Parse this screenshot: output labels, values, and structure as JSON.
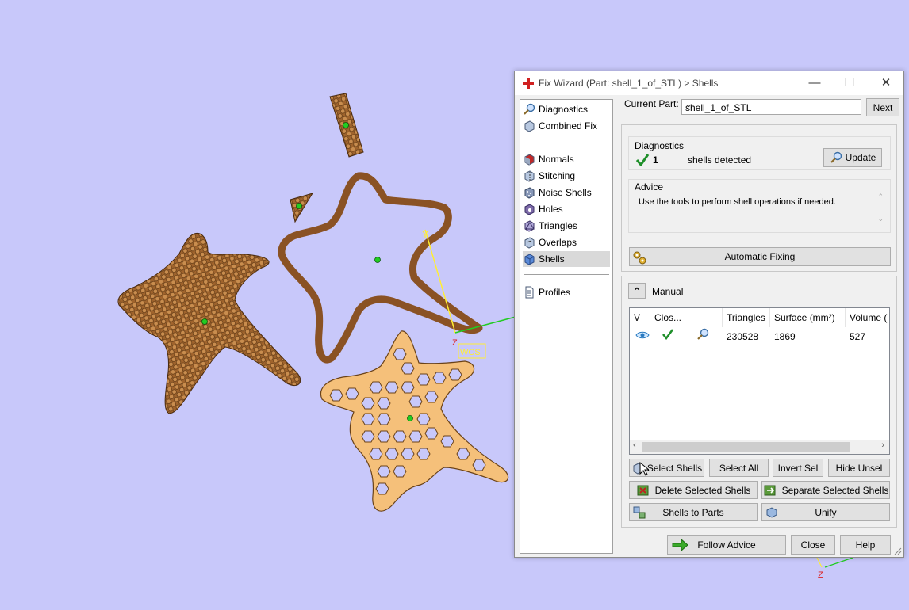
{
  "window": {
    "title": "Fix Wizard (Part: shell_1_of_STL) > Shells",
    "minimize_label": "—",
    "maximize_label": "☐",
    "close_label": "✕"
  },
  "nav": {
    "items": [
      {
        "label": "Diagnostics",
        "icon": "magnifier-icon"
      },
      {
        "label": "Combined Fix",
        "icon": "cube-icon"
      },
      {
        "label": "Normals",
        "icon": "normals-icon"
      },
      {
        "label": "Stitching",
        "icon": "stitching-icon"
      },
      {
        "label": "Noise Shells",
        "icon": "noise-shells-icon"
      },
      {
        "label": "Holes",
        "icon": "holes-icon"
      },
      {
        "label": "Triangles",
        "icon": "triangles-icon"
      },
      {
        "label": "Overlaps",
        "icon": "overlaps-icon"
      },
      {
        "label": "Shells",
        "icon": "shells-icon"
      },
      {
        "label": "Profiles",
        "icon": "document-icon"
      }
    ],
    "selected": "Shells"
  },
  "current_part": {
    "label": "Current Part:",
    "value": "shell_1_of_STL",
    "next_label": "Next"
  },
  "diagnostics": {
    "title": "Diagnostics",
    "count": "1",
    "text": "shells detected",
    "update_label": "Update"
  },
  "advice": {
    "title": "Advice",
    "text": "Use the tools to perform shell operations if needed."
  },
  "automatic_fixing_label": "Automatic Fixing",
  "manual": {
    "title": "Manual",
    "columns": [
      "V",
      "Clos...",
      "",
      "Triangles",
      "Surface (mm²)",
      "Volume ("
    ],
    "rows": [
      {
        "triangles": "230528",
        "surface": "1869",
        "volume": "527"
      }
    ]
  },
  "buttons": {
    "select_shells": "Select Shells",
    "select_all": "Select All",
    "invert_sel": "Invert Sel",
    "hide_unsel": "Hide Unsel",
    "delete_selected": "Delete Selected Shells",
    "separate_selected": "Separate Selected Shells",
    "shells_to_parts": "Shells to Parts",
    "unify": "Unify",
    "follow_advice": "Follow Advice",
    "close": "Close",
    "help": "Help"
  },
  "viewport": {
    "wcs_label": "WCS",
    "axis_y": "Y",
    "axis_z": "Z",
    "axis_z2": "Z"
  },
  "colors": {
    "background": "#c8c8fa",
    "part_dark": "#a0642d",
    "part_light": "#f5c07a",
    "axis_green": "#22cc22",
    "axis_yellow": "#ffee33",
    "axis_red": "#dd2222"
  }
}
